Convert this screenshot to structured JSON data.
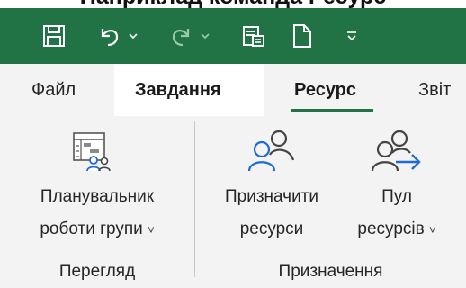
{
  "caption": "Наприклад команда Ресурс",
  "quick_access": {
    "items": [
      {
        "icon": "save-icon"
      },
      {
        "icon": "undo-icon"
      },
      {
        "icon": "undo-dropdown-icon"
      },
      {
        "icon": "redo-icon"
      },
      {
        "icon": "redo-dropdown-icon"
      },
      {
        "icon": "task-sheet-icon"
      },
      {
        "icon": "new-file-icon"
      },
      {
        "icon": "customize-qat-icon"
      }
    ]
  },
  "tabs": [
    {
      "label": "Файл",
      "active": false
    },
    {
      "label": "Завдання",
      "active": false
    },
    {
      "label": "Ресурс",
      "active": true
    },
    {
      "label": "Звіт",
      "active": false
    }
  ],
  "ribbon": {
    "groups": [
      {
        "label": "Перегляд",
        "buttons": [
          {
            "line1": "Планувальник",
            "line2": "роботи групи",
            "dropdown": "˅",
            "icon": "team-planner-icon"
          }
        ]
      },
      {
        "label": "Призначення",
        "buttons": [
          {
            "line1": "Призначити",
            "line2": "ресурси",
            "icon": "assign-resources-icon"
          },
          {
            "line1": "Пул",
            "line2": "ресурсів",
            "dropdown": "˅",
            "icon": "resource-pool-icon"
          }
        ]
      }
    ]
  },
  "colors": {
    "toolbar_green": "#217346",
    "ribbon_bg": "#f3f3f3",
    "icon_blue": "#1e6ad6"
  }
}
